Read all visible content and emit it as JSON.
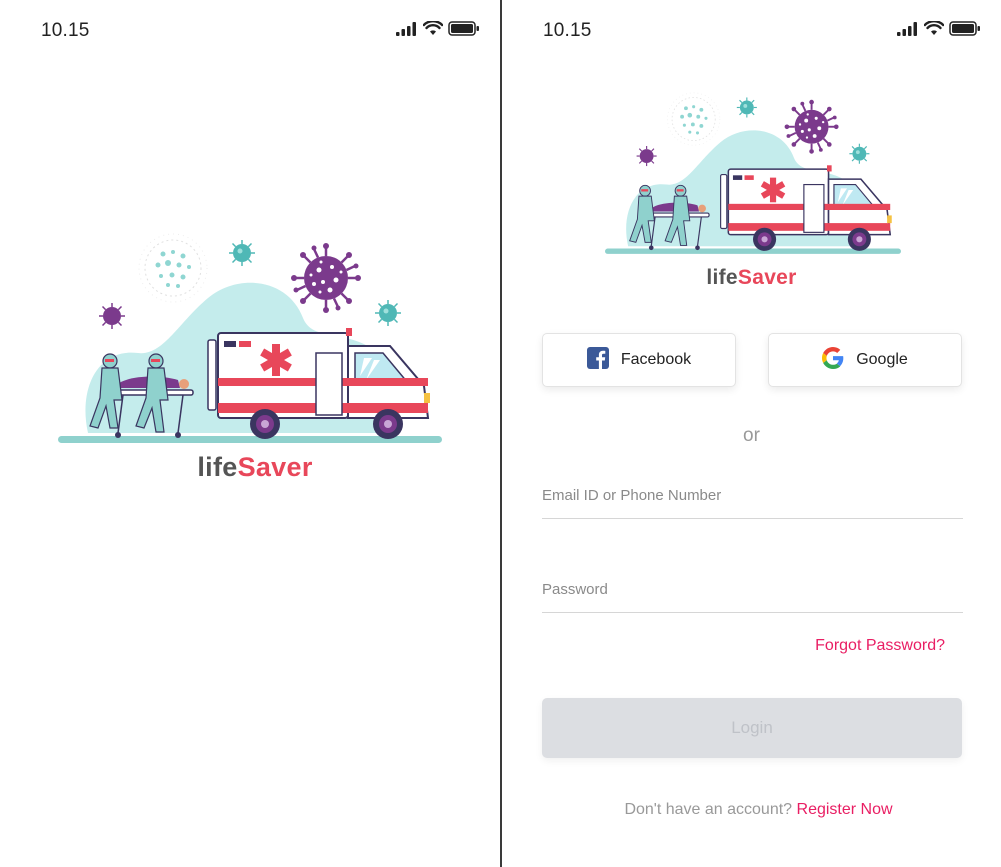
{
  "splash": {
    "status": {
      "time": "10.15",
      "icons": [
        "signal-icon",
        "wifi-icon",
        "battery-icon"
      ]
    },
    "brand": {
      "life": "life",
      "saver": "Saver"
    }
  },
  "login": {
    "status": {
      "time": "10.15",
      "icons": [
        "signal-icon",
        "wifi-icon",
        "battery-icon"
      ]
    },
    "brand": {
      "life": "life",
      "saver": "Saver"
    },
    "social": {
      "facebook_label": "Facebook",
      "google_label": "Google"
    },
    "or_text": "or",
    "email": {
      "placeholder": "Email ID or Phone Number",
      "value": ""
    },
    "password": {
      "placeholder": "Password",
      "value": ""
    },
    "forgot_label": "Forgot Password?",
    "login_label": "Login",
    "register": {
      "prompt": "Don't have an account?",
      "link": "Register Now"
    }
  },
  "colors": {
    "accent": "#e91e63",
    "brand_red": "#e8475a",
    "virus_purple": "#7b3a8c",
    "teal": "#5fc4c4",
    "facebook_blue": "#3b5998",
    "disabled_button": "#dcdee2"
  }
}
